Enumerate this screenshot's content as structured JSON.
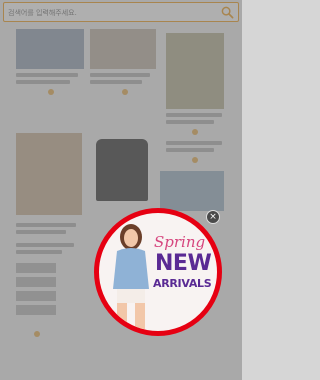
{
  "search": {
    "placeholder": "검색어를 입력해주세요."
  },
  "promo": {
    "line1": "Spring",
    "line2": "NEW",
    "line3": "ARRIVALS"
  },
  "close_glyph": "×",
  "colors": {
    "search_border": "#f0a22c",
    "promo_ring": "#e60012",
    "promo_purple": "#5a2a94",
    "promo_pink": "#d6457e"
  }
}
